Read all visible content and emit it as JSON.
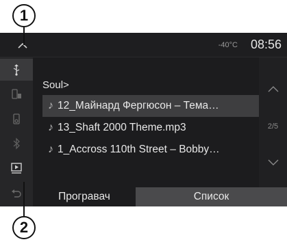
{
  "callouts": {
    "top": "1",
    "bottom": "2"
  },
  "status": {
    "temperature": "-40°C",
    "time": "08:56"
  },
  "sidebar": {
    "items": [
      {
        "icon": "usb-icon",
        "active": true
      },
      {
        "icon": "phone-media-icon",
        "active": false
      },
      {
        "icon": "ipod-icon",
        "active": false
      },
      {
        "icon": "bluetooth-icon",
        "active": false
      },
      {
        "icon": "media-play-icon",
        "active": false
      },
      {
        "icon": "back-icon",
        "active": false
      }
    ]
  },
  "breadcrumb": "Soul>",
  "tracks": [
    {
      "title": "12_Майнард Фергюсон – Тема…",
      "selected": true
    },
    {
      "title": "13_Shaft 2000 Theme.mp3",
      "selected": false
    },
    {
      "title": "1_Accross 110th Street – Bobby…",
      "selected": false
    }
  ],
  "pagination": {
    "indicator": "2/5"
  },
  "tabs": {
    "player": "Програвач",
    "list": "Список"
  },
  "colors": {
    "screen_bg": "#1c1c1e",
    "selected_row": "#3e3e40",
    "active_tab": "#4a4a4c"
  }
}
